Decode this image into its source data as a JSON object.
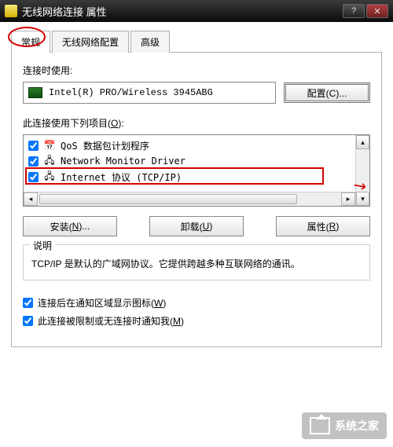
{
  "title": "无线网络连接 属性",
  "tabs": {
    "general": "常规",
    "wireless": "无线网络配置",
    "advanced": "高级"
  },
  "connectUsing": "连接时使用:",
  "adapter": "Intel(R) PRO/Wireless 3945ABG",
  "buttons": {
    "configure": "配置(C)...",
    "install": "安装(N)...",
    "uninstall": "卸载(U)",
    "properties": "属性(R)"
  },
  "itemsLabel": "此连接使用下列项目(O):",
  "items": [
    {
      "checked": true,
      "icon": "📅",
      "text": "QoS 数据包计划程序"
    },
    {
      "checked": true,
      "icon": "🖧",
      "text": "Network Monitor Driver"
    },
    {
      "checked": true,
      "icon": "🖧",
      "text": "Internet 协议 (TCP/IP)"
    }
  ],
  "descriptionLabel": "说明",
  "descriptionText": "TCP/IP 是默认的广域网协议。它提供跨越多种互联网络的通讯。",
  "opts": {
    "showIcon": "连接后在通知区域显示图标(W)",
    "notify": "此连接被限制或无连接时通知我(M)"
  },
  "watermark": "系统之家"
}
